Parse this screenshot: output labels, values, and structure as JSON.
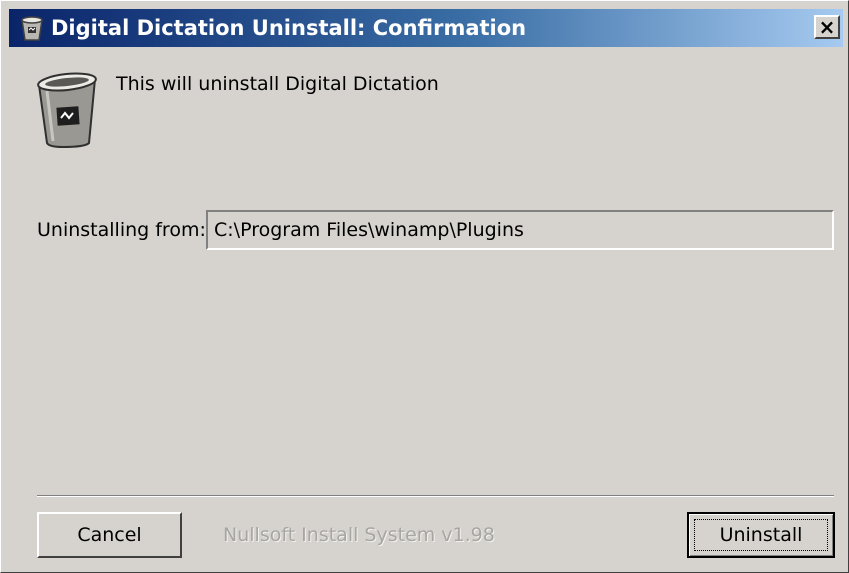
{
  "window": {
    "title": "Digital Dictation Uninstall: Confirmation",
    "close_glyph": "×",
    "title_icon": "recycle-bin-icon"
  },
  "content": {
    "icon": "recycle-bin-icon",
    "message": "This will uninstall Digital Dictation",
    "from_label": "Uninstalling from:",
    "path_value": "C:\\Program Files\\winamp\\Plugins"
  },
  "footer": {
    "cancel_label": "Cancel",
    "branding": "Nullsoft Install System v1.98",
    "uninstall_label": "Uninstall"
  },
  "colors": {
    "face": "#d6d3ce",
    "titlebar_start": "#0a246a",
    "titlebar_end": "#a6caf0",
    "disabled_text": "#a8a6a2"
  }
}
